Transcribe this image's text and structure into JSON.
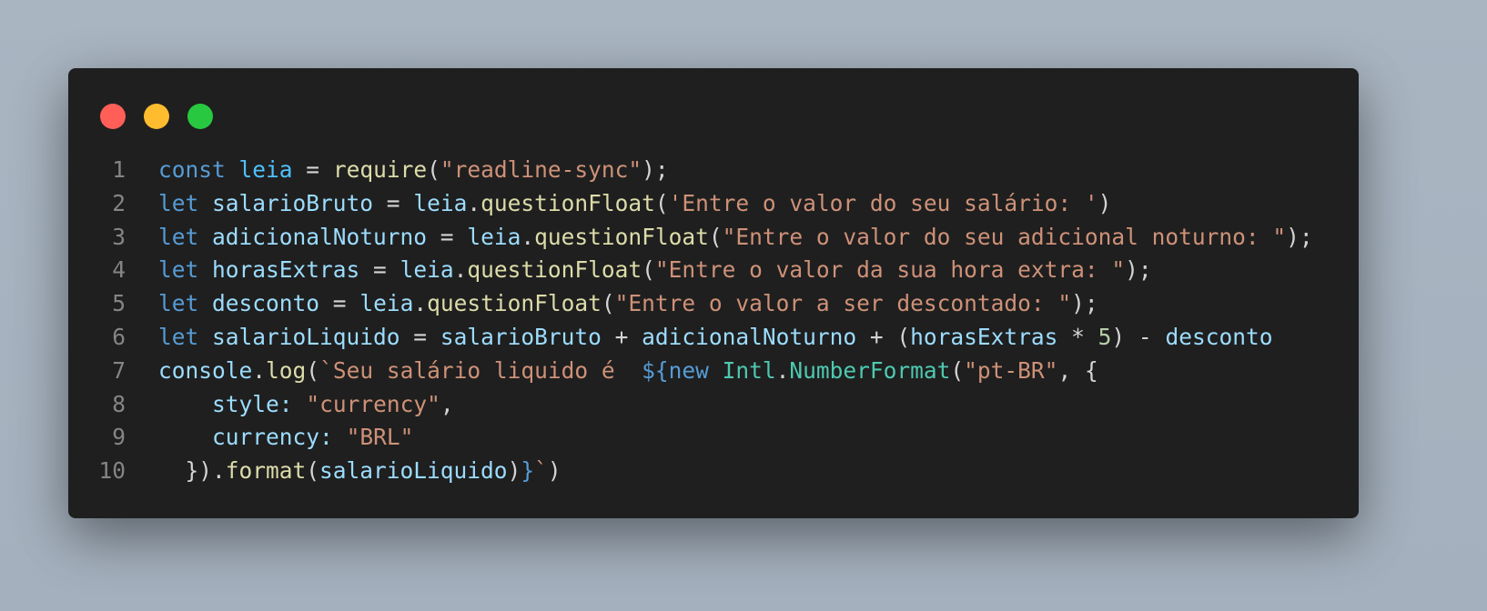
{
  "window": {
    "controls": [
      {
        "name": "close",
        "color": "#ff5f57"
      },
      {
        "name": "minimize",
        "color": "#febc2e"
      },
      {
        "name": "maximize",
        "color": "#28c840"
      }
    ]
  },
  "code": {
    "language": "javascript",
    "lines": [
      {
        "number": "1",
        "tokens": [
          [
            "keyword",
            "const"
          ],
          [
            "punct",
            " "
          ],
          [
            "const",
            "leia"
          ],
          [
            "punct",
            " = "
          ],
          [
            "func",
            "require"
          ],
          [
            "punct",
            "("
          ],
          [
            "string",
            "\"readline-sync\""
          ],
          [
            "punct",
            ");"
          ]
        ]
      },
      {
        "number": "2",
        "tokens": [
          [
            "keyword",
            "let"
          ],
          [
            "punct",
            " "
          ],
          [
            "var",
            "salarioBruto"
          ],
          [
            "punct",
            " = "
          ],
          [
            "var",
            "leia"
          ],
          [
            "punct",
            "."
          ],
          [
            "func",
            "questionFloat"
          ],
          [
            "punct",
            "("
          ],
          [
            "string",
            "'Entre o valor do seu salário: '"
          ],
          [
            "punct",
            ")"
          ]
        ]
      },
      {
        "number": "3",
        "tokens": [
          [
            "keyword",
            "let"
          ],
          [
            "punct",
            " "
          ],
          [
            "var",
            "adicionalNoturno"
          ],
          [
            "punct",
            " = "
          ],
          [
            "var",
            "leia"
          ],
          [
            "punct",
            "."
          ],
          [
            "func",
            "questionFloat"
          ],
          [
            "punct",
            "("
          ],
          [
            "string",
            "\"Entre o valor do seu adicional noturno: \""
          ],
          [
            "punct",
            ");"
          ]
        ]
      },
      {
        "number": "4",
        "tokens": [
          [
            "keyword",
            "let"
          ],
          [
            "punct",
            " "
          ],
          [
            "var",
            "horasExtras"
          ],
          [
            "punct",
            " = "
          ],
          [
            "var",
            "leia"
          ],
          [
            "punct",
            "."
          ],
          [
            "func",
            "questionFloat"
          ],
          [
            "punct",
            "("
          ],
          [
            "string",
            "\"Entre o valor da sua hora extra: \""
          ],
          [
            "punct",
            ");"
          ]
        ]
      },
      {
        "number": "5",
        "tokens": [
          [
            "keyword",
            "let"
          ],
          [
            "punct",
            " "
          ],
          [
            "var",
            "desconto"
          ],
          [
            "punct",
            " = "
          ],
          [
            "var",
            "leia"
          ],
          [
            "punct",
            "."
          ],
          [
            "func",
            "questionFloat"
          ],
          [
            "punct",
            "("
          ],
          [
            "string",
            "\"Entre o valor a ser descontado: \""
          ],
          [
            "punct",
            ");"
          ]
        ]
      },
      {
        "number": "6",
        "tokens": [
          [
            "keyword",
            "let"
          ],
          [
            "punct",
            " "
          ],
          [
            "var",
            "salarioLiquido"
          ],
          [
            "punct",
            " = "
          ],
          [
            "var",
            "salarioBruto"
          ],
          [
            "punct",
            " + "
          ],
          [
            "var",
            "adicionalNoturno"
          ],
          [
            "punct",
            " + ("
          ],
          [
            "var",
            "horasExtras"
          ],
          [
            "punct",
            " * "
          ],
          [
            "number",
            "5"
          ],
          [
            "punct",
            ") - "
          ],
          [
            "var",
            "desconto"
          ]
        ]
      },
      {
        "number": "7",
        "tokens": [
          [
            "var",
            "console"
          ],
          [
            "punct",
            "."
          ],
          [
            "func",
            "log"
          ],
          [
            "punct",
            "("
          ],
          [
            "string",
            "`Seu salário liquido é  "
          ],
          [
            "keyword",
            "${new"
          ],
          [
            "punct",
            " "
          ],
          [
            "class",
            "Intl"
          ],
          [
            "punct",
            "."
          ],
          [
            "class",
            "NumberFormat"
          ],
          [
            "punct",
            "("
          ],
          [
            "string",
            "\"pt-BR\""
          ],
          [
            "punct",
            ", {"
          ]
        ]
      },
      {
        "number": "8",
        "tokens": [
          [
            "punct",
            "    "
          ],
          [
            "var",
            "style"
          ],
          [
            "var",
            ":"
          ],
          [
            "punct",
            " "
          ],
          [
            "string",
            "\"currency\""
          ],
          [
            "punct",
            ","
          ]
        ]
      },
      {
        "number": "9",
        "tokens": [
          [
            "punct",
            "    "
          ],
          [
            "var",
            "currency"
          ],
          [
            "var",
            ":"
          ],
          [
            "punct",
            " "
          ],
          [
            "string",
            "\"BRL\""
          ]
        ]
      },
      {
        "number": "10",
        "tokens": [
          [
            "punct",
            "  })."
          ],
          [
            "func",
            "format"
          ],
          [
            "punct",
            "("
          ],
          [
            "var",
            "salarioLiquido"
          ],
          [
            "punct",
            ")"
          ],
          [
            "keyword",
            "}"
          ],
          [
            "string",
            "`"
          ],
          [
            "punct",
            ")"
          ]
        ]
      }
    ]
  }
}
